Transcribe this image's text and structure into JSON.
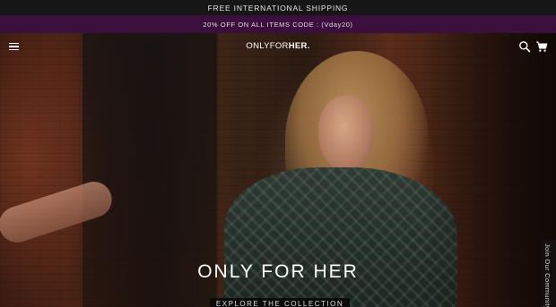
{
  "announcement": {
    "shipping": "FREE INTERNATIONAL SHIPPING"
  },
  "promo": {
    "text": "20% OFF ON ALL ITEMS CODE : (Vday20)"
  },
  "header": {
    "logo_part1": "ONLY",
    "logo_part2": "FOR",
    "logo_part3": "HER.",
    "icons": [
      "menu-icon",
      "search-icon",
      "cart-icon"
    ]
  },
  "hero": {
    "title": "ONLY FOR HER",
    "cta_label": "EXPLORE THE COLLECTION"
  },
  "community_tab": {
    "label": "Join Our Community"
  },
  "colors": {
    "topbar": "#161616",
    "promobar": "#3a0f3b",
    "text": "#ffffff"
  }
}
